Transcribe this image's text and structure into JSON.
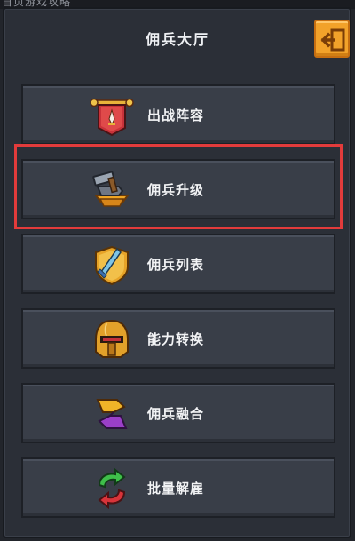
{
  "top_strip": {
    "text": "首页游戏攻略"
  },
  "title": "佣兵大厅",
  "back_button": {
    "icon": "back-arrow-icon",
    "color": "#f2a22a"
  },
  "menu": [
    {
      "label": "出战阵容",
      "icon": "banner-icon"
    },
    {
      "label": "佣兵升级",
      "icon": "anvil-hammer-icon"
    },
    {
      "label": "佣兵列表",
      "icon": "sword-shield-icon"
    },
    {
      "label": "能力转换",
      "icon": "helmet-icon"
    },
    {
      "label": "佣兵融合",
      "icon": "merge-arrows-icon"
    },
    {
      "label": "批量解雇",
      "icon": "recycle-arrows-icon"
    }
  ],
  "highlighted_item": "佣兵升级",
  "colors": {
    "panel": "#2b2f37",
    "button": "#393e48",
    "highlight": "#e23b3b",
    "accent": "#f2a22a"
  }
}
